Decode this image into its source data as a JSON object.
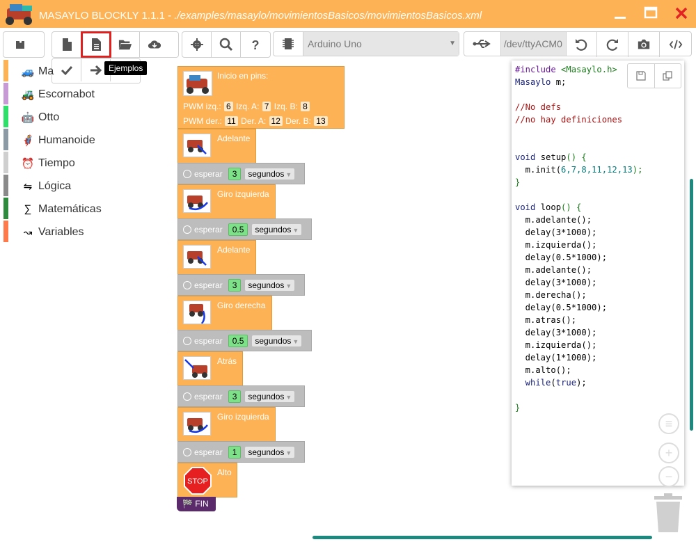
{
  "window": {
    "app_name": "MASAYLO BLOCKLY 1.1.1 - ",
    "file_path": "./examples/masaylo/movimientosBasicos/movimientosBasicos.xml",
    "minimize_icon": "minimize-icon",
    "maximize_icon": "maximize-icon",
    "close_icon": "close-icon"
  },
  "toolbar": {
    "board": "Arduino Uno",
    "port": "/dev/ttyACM0",
    "tooltip": "Ejemplos"
  },
  "categories": [
    {
      "label": "Ma",
      "color": "#fdb355",
      "icon": "🚙"
    },
    {
      "label": "Escornabot",
      "color": "#c79ad6",
      "icon": "🚜"
    },
    {
      "label": "Otto",
      "color": "#2ee06a",
      "icon": "🤖"
    },
    {
      "label": "Humanoide",
      "color": "#8c9aa6",
      "icon": "🦸"
    },
    {
      "label": "Tiempo",
      "color": "#cfcfcf",
      "icon": "⏰"
    },
    {
      "label": "Lógica",
      "color": "#8a8a8a",
      "icon": "⇋"
    },
    {
      "label": "Matemáticas",
      "color": "#2e8b3e",
      "icon": "∑"
    },
    {
      "label": "Variables",
      "color": "#ff7a4a",
      "icon": "↝"
    }
  ],
  "blocks": {
    "init": {
      "title": "Inicio en pins:",
      "pwm_izq_label": "PWM izq.:",
      "pwm_izq": "6",
      "izq_a_label": "Izq. A:",
      "izq_a": "7",
      "izq_b_label": "Izq. B:",
      "izq_b": "8",
      "pwm_der_label": "PWM der.:",
      "pwm_der": "11",
      "der_a_label": "Der. A:",
      "der_a": "12",
      "der_b_label": "Der. B:",
      "der_b": "13"
    },
    "wait_label": "esperar",
    "unit_label": "segundos",
    "sequence": [
      {
        "action": "Adelante",
        "wait": "3"
      },
      {
        "action": "Giro izquierda",
        "wait": "0.5"
      },
      {
        "action": "Adelante",
        "wait": "3"
      },
      {
        "action": "Giro derecha",
        "wait": "0.5"
      },
      {
        "action": "Atrás",
        "wait": "3"
      },
      {
        "action": "Giro izquierda",
        "wait": "1"
      }
    ],
    "stop": "Alto",
    "stop_sign": "STOP",
    "end": "FIN"
  },
  "code": {
    "l1a": "#include ",
    "l1b": "<Masaylo.h>",
    "l2a": "Masaylo",
    "l2b": " m;",
    "l4": "//No defs",
    "l5": "//no hay definiciones",
    "setup_kw": "void",
    "setup_fn": " setup",
    "setup_end": "() {",
    "init_line_a": "  m.init(",
    "init_args": "6,7,8,11,12,13",
    "init_line_b": ");",
    "close": "}",
    "loop_kw": "void",
    "loop_fn": " loop",
    "loop_end": "() {",
    "l_adelante1": "  m.adelante();",
    "l_delay1": "  delay(3*1000);",
    "l_izq1": "  m.izquierda();",
    "l_delay2": "  delay(0.5*1000);",
    "l_adelante2": "  m.adelante();",
    "l_delay3": "  delay(3*1000);",
    "l_der": "  m.derecha();",
    "l_delay4": "  delay(0.5*1000);",
    "l_atras": "  m.atras();",
    "l_delay5": "  delay(3*1000);",
    "l_izq2": "  m.izquierda();",
    "l_delay6": "  delay(1*1000);",
    "l_alto": "  m.alto();",
    "l_while_kw": "  while",
    "l_while_true": "true",
    "l_while_end": ");",
    "l_while_open": "(",
    "close2": "}"
  }
}
